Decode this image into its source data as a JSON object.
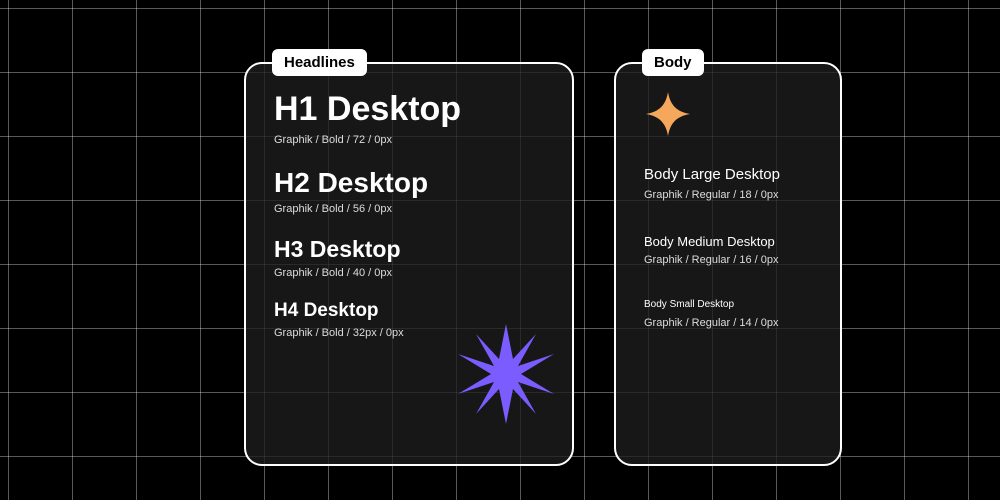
{
  "panels": {
    "headlines": {
      "tab": "Headlines",
      "items": [
        {
          "title": "H1 Desktop",
          "spec": "Graphik / Bold / 72 / 0px"
        },
        {
          "title": "H2 Desktop",
          "spec": "Graphik / Bold / 56 / 0px"
        },
        {
          "title": "H3 Desktop",
          "spec": "Graphik / Bold / 40 / 0px"
        },
        {
          "title": "H4 Desktop",
          "spec": "Graphik / Bold / 32px / 0px"
        }
      ]
    },
    "body": {
      "tab": "Body",
      "items": [
        {
          "title": "Body Large Desktop",
          "spec": "Graphik / Regular / 18 / 0px"
        },
        {
          "title": "Body Medium Desktop",
          "spec": "Graphik / Regular / 16 / 0px"
        },
        {
          "title": "Body Small Desktop",
          "spec": "Graphik / Regular / 14 / 0px"
        }
      ]
    }
  },
  "colors": {
    "star": "#7A5CFF",
    "sparkle": "#F5A85C"
  }
}
